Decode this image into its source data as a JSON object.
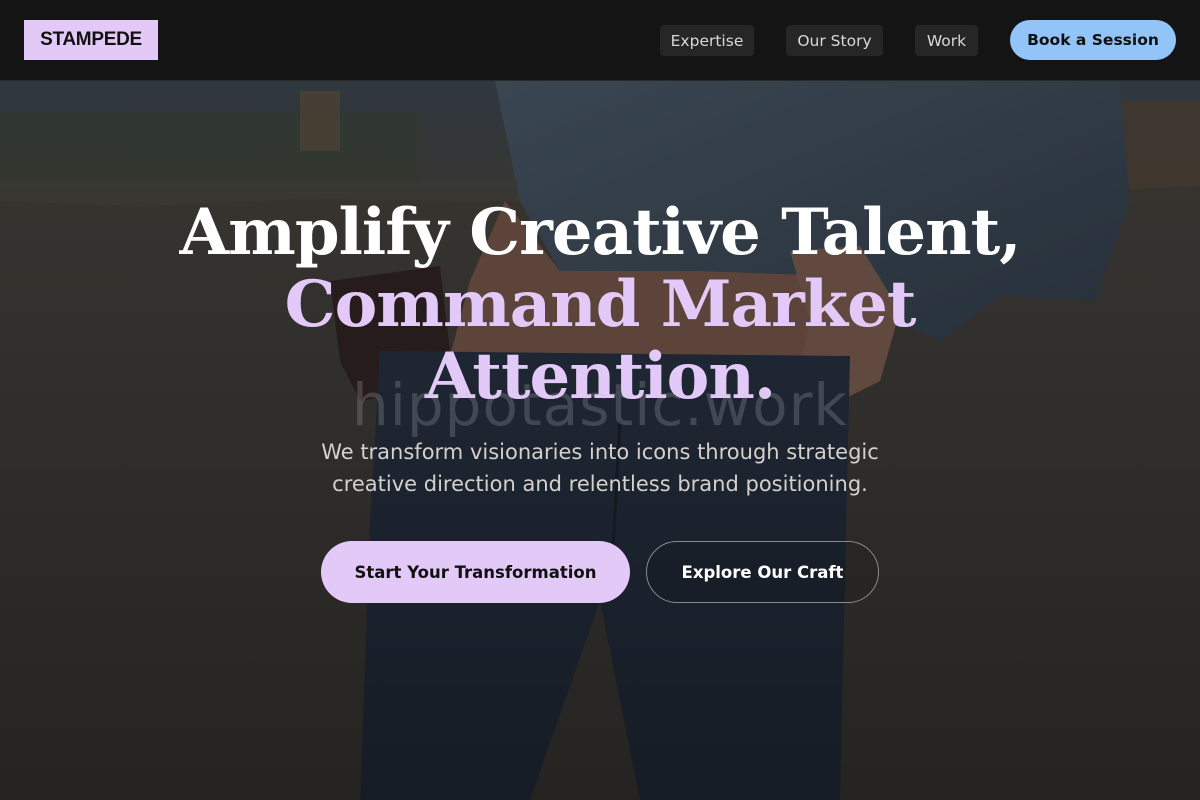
{
  "header": {
    "logo": "STAMPEDE",
    "nav": [
      "Expertise",
      "Our Story",
      "Work"
    ],
    "cta_label": "Book a Session"
  },
  "hero": {
    "headline_line1": "Amplify Creative Talent,",
    "headline_line2": "Command Market",
    "headline_line3": "Attention.",
    "watermark": "hippotastic.work",
    "subtitle": "We transform visionaries into icons through strategic creative direction and relentless brand positioning.",
    "primary_button": "Start Your Transformation",
    "secondary_button": "Explore Our Craft",
    "background_image": "person-denim-jacket-jeans-photo"
  },
  "colors": {
    "accent_lavender": "#e3c9f7",
    "cta_blue": "#93c4f7",
    "header_bg": "#141414"
  }
}
